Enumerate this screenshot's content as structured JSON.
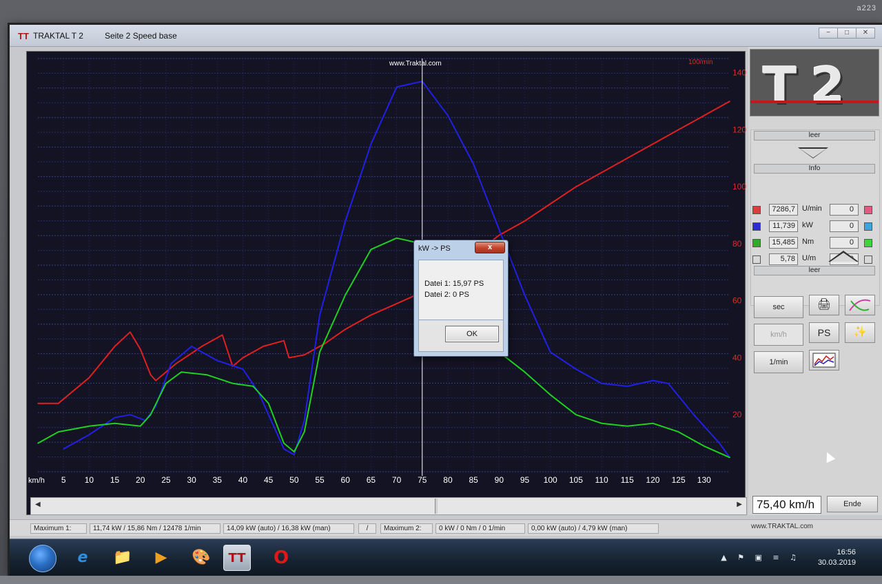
{
  "bezel_brand": "a223",
  "window": {
    "app_name": "TRAKTAL   T 2",
    "page": "Seite 2   Speed base",
    "btn_min": "−",
    "btn_max": "□",
    "btn_close": "✕"
  },
  "chart_data": {
    "type": "line",
    "watermark": "www.Traktal.com",
    "xlabel": "km/h",
    "x_ticks": [
      5,
      10,
      15,
      20,
      25,
      30,
      35,
      40,
      45,
      50,
      55,
      60,
      65,
      70,
      75,
      80,
      85,
      90,
      95,
      100,
      105,
      110,
      115,
      120,
      125,
      130
    ],
    "xlim": [
      0,
      135
    ],
    "right_axis_unit": "100/min",
    "right_ticks": [
      20,
      40,
      60,
      80,
      100,
      120,
      140
    ],
    "right_ylim": [
      0,
      145
    ],
    "cursor_x": 75,
    "series": [
      {
        "color": "#e02020",
        "points": [
          [
            0,
            24
          ],
          [
            4,
            24
          ],
          [
            10,
            33
          ],
          [
            15,
            44
          ],
          [
            18,
            49
          ],
          [
            20,
            43
          ],
          [
            22,
            34
          ],
          [
            23,
            32
          ],
          [
            27,
            38
          ],
          [
            32,
            44
          ],
          [
            36,
            48
          ],
          [
            38,
            37
          ],
          [
            40,
            40
          ],
          [
            44,
            44
          ],
          [
            48,
            46
          ],
          [
            49,
            40
          ],
          [
            52,
            41
          ],
          [
            56,
            45
          ],
          [
            60,
            50
          ],
          [
            65,
            55
          ],
          [
            70,
            59
          ],
          [
            75,
            63
          ],
          [
            80,
            70
          ],
          [
            85,
            76
          ],
          [
            90,
            83
          ],
          [
            95,
            88
          ],
          [
            100,
            94
          ],
          [
            105,
            100
          ],
          [
            110,
            105
          ],
          [
            115,
            110
          ],
          [
            120,
            115
          ],
          [
            125,
            120
          ],
          [
            130,
            125
          ],
          [
            135,
            130
          ]
        ]
      },
      {
        "color": "#2020e8",
        "points": [
          [
            5,
            8
          ],
          [
            10,
            13
          ],
          [
            15,
            19
          ],
          [
            18,
            20
          ],
          [
            21,
            18
          ],
          [
            23,
            23
          ],
          [
            26,
            38
          ],
          [
            30,
            44
          ],
          [
            35,
            39
          ],
          [
            40,
            36
          ],
          [
            43,
            28
          ],
          [
            45,
            20
          ],
          [
            48,
            8
          ],
          [
            50,
            6
          ],
          [
            52,
            18
          ],
          [
            55,
            55
          ],
          [
            60,
            88
          ],
          [
            65,
            115
          ],
          [
            70,
            135
          ],
          [
            75,
            137
          ],
          [
            80,
            125
          ],
          [
            85,
            108
          ],
          [
            90,
            85
          ],
          [
            95,
            62
          ],
          [
            100,
            42
          ],
          [
            105,
            36
          ],
          [
            110,
            31
          ],
          [
            115,
            30
          ],
          [
            120,
            32
          ],
          [
            123,
            31
          ],
          [
            128,
            20
          ],
          [
            133,
            10
          ],
          [
            135,
            5
          ]
        ]
      },
      {
        "color": "#20d020",
        "points": [
          [
            0,
            10
          ],
          [
            4,
            14
          ],
          [
            10,
            16
          ],
          [
            15,
            17
          ],
          [
            20,
            16
          ],
          [
            22,
            20
          ],
          [
            25,
            31
          ],
          [
            28,
            35
          ],
          [
            33,
            34
          ],
          [
            38,
            31
          ],
          [
            42,
            30
          ],
          [
            45,
            24
          ],
          [
            48,
            10
          ],
          [
            50,
            7
          ],
          [
            52,
            14
          ],
          [
            55,
            42
          ],
          [
            60,
            62
          ],
          [
            65,
            78
          ],
          [
            70,
            82
          ],
          [
            75,
            80
          ],
          [
            80,
            70
          ],
          [
            85,
            55
          ],
          [
            90,
            42
          ],
          [
            95,
            35
          ],
          [
            100,
            27
          ],
          [
            105,
            20
          ],
          [
            110,
            17
          ],
          [
            115,
            16
          ],
          [
            120,
            17
          ],
          [
            125,
            14
          ],
          [
            130,
            9
          ],
          [
            135,
            5
          ]
        ]
      }
    ]
  },
  "panel": {
    "slot_top": "leer",
    "info_label": "Info",
    "slot_bottom": "leer",
    "channels": [
      {
        "color": "#e03b3b",
        "value": "7286,7",
        "unit": "U/min",
        "value2": "0",
        "color2": "#e55a82"
      },
      {
        "color": "#2b2bd8",
        "value": "11,739",
        "unit": "kW",
        "value2": "0",
        "color2": "#3aa7d8"
      },
      {
        "color": "#2faa2f",
        "value": "15,485",
        "unit": "Nm",
        "value2": "0",
        "color2": "#3ad63a"
      },
      {
        "color": "#d8d8d8",
        "value": "5,78",
        "unit": "U/m",
        "value2": "0",
        "color2": "#d8d8d8"
      }
    ],
    "buttons": {
      "sec": "sec",
      "kmh": "km/h",
      "ps": "PS",
      "rpm": "1/min",
      "print_icon": "🖨",
      "magic_icon": "✨"
    }
  },
  "speed_display": "75,40 km/h",
  "ende_label": "Ende",
  "status": {
    "max1_label": "Maximum 1:",
    "max1_values": "11,74 kW  /  15,86 Nm  /  12478 1/min",
    "max1_power": "14,09 kW (auto)  /  16,38 kW (man)",
    "separator": "/",
    "max2_label": "Maximum 2:",
    "max2_values": "0 kW  /  0 Nm  /  0 1/min",
    "max2_power": "0,00 kW (auto)  /  4,79 kW (man)",
    "url": "www.TRAKTAL.com"
  },
  "dialog": {
    "title": "kW -> PS",
    "close": "x",
    "line1": "Datei 1: 15,97 PS",
    "line2": "Datei 2: 0 PS",
    "ok": "OK"
  },
  "taskbar": {
    "ie_icon": "e",
    "folder_icon": "📁",
    "media_icon": "▶",
    "paint_icon": "🎨",
    "traktal_icon": "TT",
    "opera_icon": "O",
    "tray_icons": "▲ ⚑ ▣ ≡ ♫",
    "time": "16:56",
    "date": "30.03.2019"
  }
}
